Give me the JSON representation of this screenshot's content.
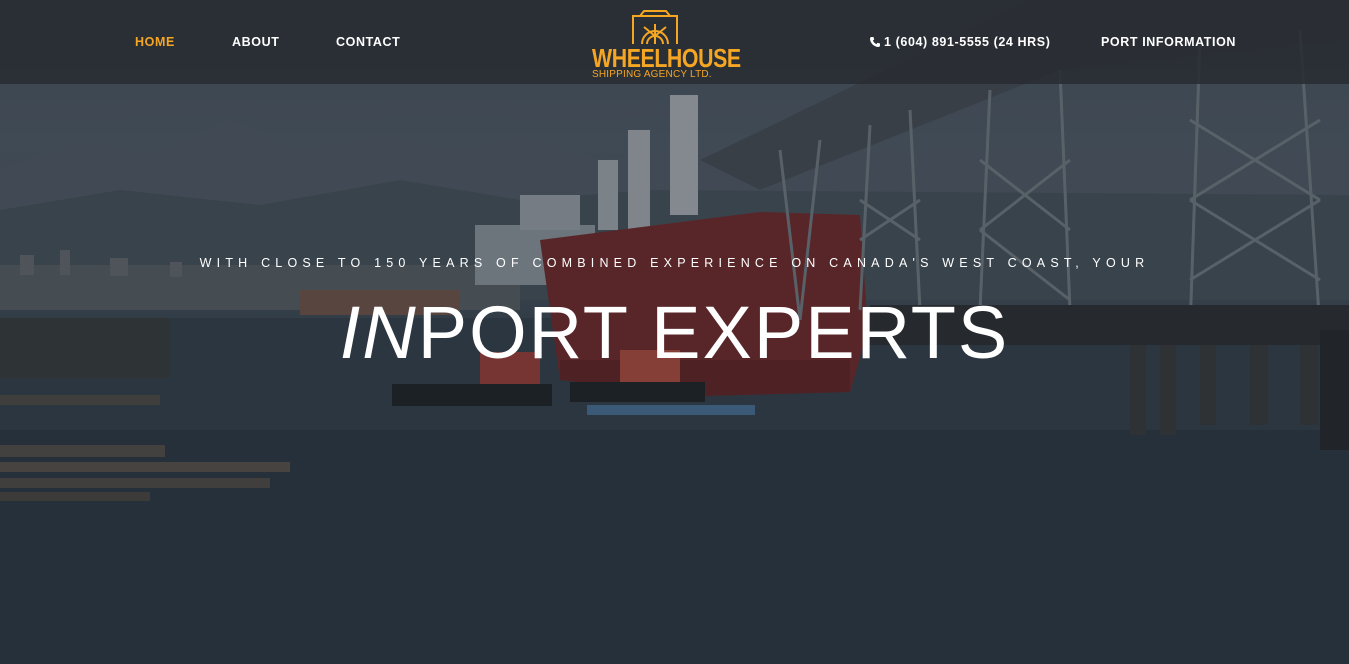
{
  "nav": {
    "home": "HOME",
    "about": "ABOUT",
    "contact": "CONTACT",
    "phone": "1 (604) 891-5555 (24 HRS)",
    "port_information": "PORT INFORMATION",
    "active_color": "#f5a623"
  },
  "logo": {
    "title": "WHEELHOUSE",
    "subtitle": "SHIPPING AGENCY LTD.",
    "color": "#f5a623",
    "icon": "ship-wheel-icon"
  },
  "hero": {
    "tagline": "WITH CLOSE TO 150 YEARS OF COMBINED EXPERIENCE ON CANADA'S WEST COAST, YOUR",
    "headline_italic": "IN",
    "headline_rest": "PORT EXPERTS",
    "accent_color": "#3b5a78"
  }
}
